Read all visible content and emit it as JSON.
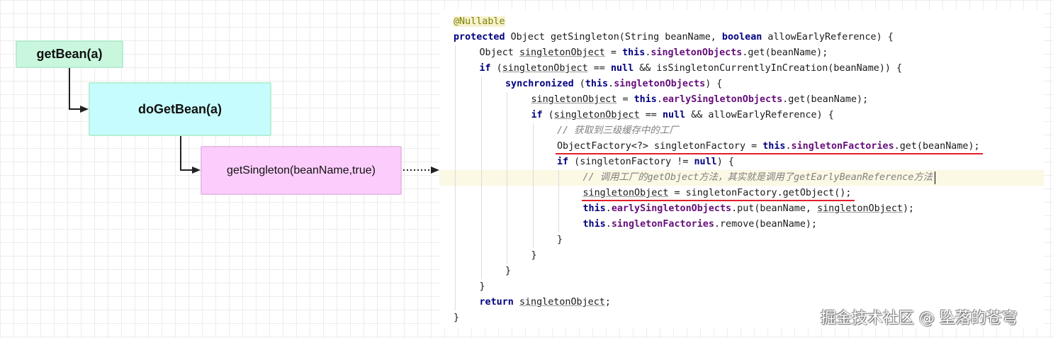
{
  "diagram": {
    "nodes": [
      {
        "id": "getbean",
        "label": "getBean(a)"
      },
      {
        "id": "dogetbean",
        "label": "doGetBean(a)"
      },
      {
        "id": "getsingleton",
        "label": "getSingleton(beanName,true)"
      }
    ]
  },
  "code": {
    "lines": [
      [
        {
          "t": "@Nullable",
          "c": "ann"
        }
      ],
      [
        {
          "t": "protected",
          "c": "kw"
        },
        {
          "t": " Object getSingleton(String beanName, "
        },
        {
          "t": "boolean",
          "c": "kw"
        },
        {
          "t": " allowEarlyReference) {"
        }
      ],
      [
        {
          "t": "Object "
        },
        {
          "t": "singletonObject",
          "c": "uv"
        },
        {
          "t": " = "
        },
        {
          "t": "this",
          "c": "kw"
        },
        {
          "t": "."
        },
        {
          "t": "singletonObjects",
          "c": "field"
        },
        {
          "t": ".get(beanName);"
        }
      ],
      [
        {
          "t": "if",
          "c": "kw"
        },
        {
          "t": " ("
        },
        {
          "t": "singletonObject",
          "c": "uv"
        },
        {
          "t": " == "
        },
        {
          "t": "null",
          "c": "kw"
        },
        {
          "t": " && isSingletonCurrentlyInCreation(beanName)) {"
        }
      ],
      [
        {
          "t": "synchronized",
          "c": "kw"
        },
        {
          "t": " ("
        },
        {
          "t": "this",
          "c": "kw"
        },
        {
          "t": "."
        },
        {
          "t": "singletonObjects",
          "c": "field"
        },
        {
          "t": ") {"
        }
      ],
      [
        {
          "t": "singletonObject",
          "c": "uv"
        },
        {
          "t": " = "
        },
        {
          "t": "this",
          "c": "kw"
        },
        {
          "t": "."
        },
        {
          "t": "earlySingletonObjects",
          "c": "field"
        },
        {
          "t": ".get(beanName);"
        }
      ],
      [
        {
          "t": "if",
          "c": "kw"
        },
        {
          "t": " ("
        },
        {
          "t": "singletonObject",
          "c": "uv"
        },
        {
          "t": " == "
        },
        {
          "t": "null",
          "c": "kw"
        },
        {
          "t": " && allowEarlyReference) {"
        }
      ],
      [
        {
          "t": "// 获取到三级缓存中的工厂",
          "c": "cmt"
        }
      ],
      [
        {
          "t": "ObjectFactory<?> singletonFactory = "
        },
        {
          "t": "this",
          "c": "kw"
        },
        {
          "t": "."
        },
        {
          "t": "singletonFactories",
          "c": "field"
        },
        {
          "t": ".get(beanName);"
        }
      ],
      [
        {
          "t": "if",
          "c": "kw"
        },
        {
          "t": " (singletonFactory != "
        },
        {
          "t": "null",
          "c": "kw"
        },
        {
          "t": ") {"
        }
      ],
      [
        {
          "t": "// 调用工厂的getObject方法，其实就是调用了getEarlyBeanReference方法",
          "c": "cmt"
        }
      ],
      [
        {
          "t": "singletonObject",
          "c": "uv"
        },
        {
          "t": " = singletonFactory.getObject();"
        }
      ],
      [
        {
          "t": "this",
          "c": "kw"
        },
        {
          "t": "."
        },
        {
          "t": "earlySingletonObjects",
          "c": "field"
        },
        {
          "t": ".put(beanName, "
        },
        {
          "t": "singletonObject",
          "c": "uv"
        },
        {
          "t": ");"
        }
      ],
      [
        {
          "t": "this",
          "c": "kw"
        },
        {
          "t": "."
        },
        {
          "t": "singletonFactories",
          "c": "field"
        },
        {
          "t": ".remove(beanName);"
        }
      ],
      [
        {
          "t": "}"
        }
      ],
      [
        {
          "t": "}"
        }
      ],
      [
        {
          "t": "}"
        }
      ],
      [
        {
          "t": "}"
        }
      ],
      [
        {
          "t": "return",
          "c": "kw"
        },
        {
          "t": " "
        },
        {
          "t": "singletonObject",
          "c": "uv"
        },
        {
          "t": ";"
        }
      ],
      [
        {
          "t": "}"
        }
      ]
    ]
  },
  "watermark": "掘金技术社区 @ 坠落的苍穹"
}
